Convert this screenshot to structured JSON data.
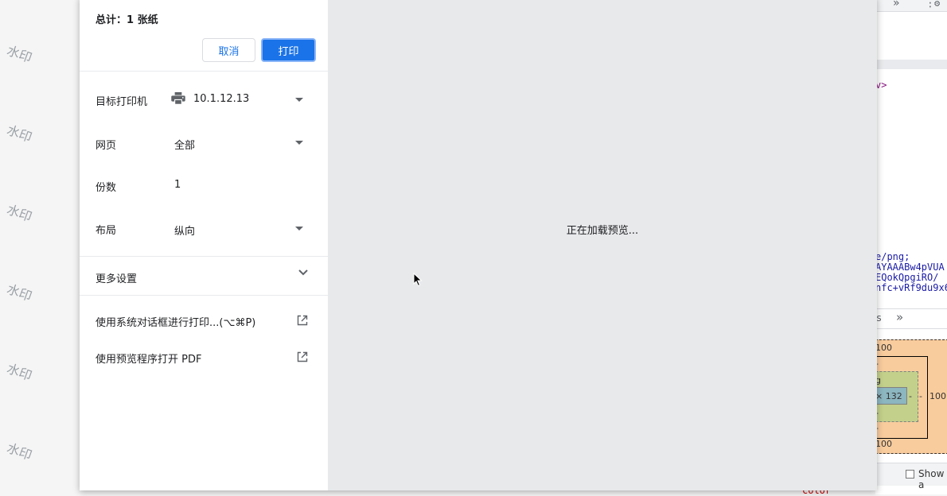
{
  "watermark": {
    "text": "水印"
  },
  "dialog": {
    "total_label": "总计：1 张纸",
    "cancel_label": "取消",
    "print_label": "打印",
    "destination": {
      "label": "目标打印机",
      "value": "10.1.12.13"
    },
    "pages": {
      "label": "网页",
      "value": "全部"
    },
    "copies": {
      "label": "份数",
      "value": "1"
    },
    "layout": {
      "label": "布局",
      "value": "纵向"
    },
    "more_settings_label": "更多设置",
    "system_dialog_label": "使用系统对话框进行打印...(⌥⌘P)",
    "open_pdf_label": "使用预览程序打开 PDF",
    "preview_loading": "正在加载预览..."
  },
  "devtools": {
    "tag_fragment": "v>",
    "code_lines": [
      "e/png;",
      "AYAAABw4pVUA",
      "EQokQpgiRO/",
      "nfc+vRf9du9x6"
    ],
    "tab_fragment": "es",
    "tab_more": "»",
    "top_more": "»",
    "box_model": {
      "margin_top": "100",
      "margin_bottom": "100",
      "margin_right": "100",
      "border_top": "-",
      "border_bottom": "-",
      "padding_label": "g",
      "padding_bottom": "-",
      "content_size": "× 132",
      "dash": "-"
    },
    "show_label": "Show a",
    "color_fragment": "color"
  },
  "colors": {
    "accent": "#1a73e8",
    "preview_bg": "#e8e9eb",
    "watermark": "#9aa0a6"
  }
}
